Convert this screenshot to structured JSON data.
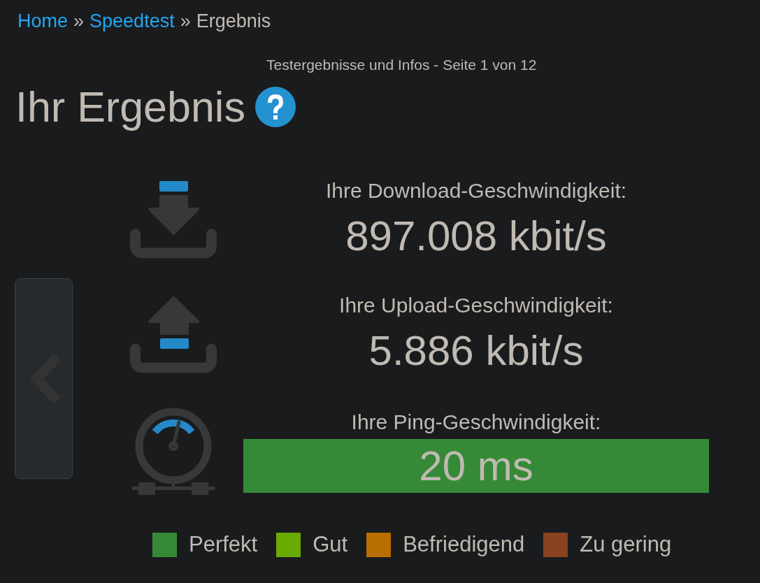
{
  "breadcrumb": [
    {
      "kind": "link",
      "label": "Home"
    },
    {
      "kind": "separator",
      "label": "»"
    },
    {
      "kind": "link",
      "label": "Speedtest"
    },
    {
      "kind": "separator",
      "label": "»"
    },
    {
      "kind": "current",
      "label": "Ergebnis"
    }
  ],
  "header": {
    "page_info": "Testergebnisse und Infos - Seite 1 von 12",
    "title": "Ihr Ergebnis"
  },
  "results": [
    {
      "kind": "download",
      "label": "Ihre Download-Geschwindigkeit:",
      "value": "897.008 kbit/s"
    },
    {
      "kind": "upload",
      "label": "Ihre Upload-Geschwindigkeit:",
      "value": "5.886 kbit/s"
    },
    {
      "kind": "ping",
      "label": "Ihre Ping-Geschwindigkeit:",
      "value": "20 ms",
      "color": "#368a37"
    }
  ],
  "legend": [
    {
      "label": "Perfekt",
      "color": "#368a37"
    },
    {
      "label": "Gut",
      "color": "#6aab03"
    },
    {
      "label": "Befriedigend",
      "color": "#b96e00"
    },
    {
      "label": "Zu gering",
      "color": "#8a421f"
    }
  ]
}
